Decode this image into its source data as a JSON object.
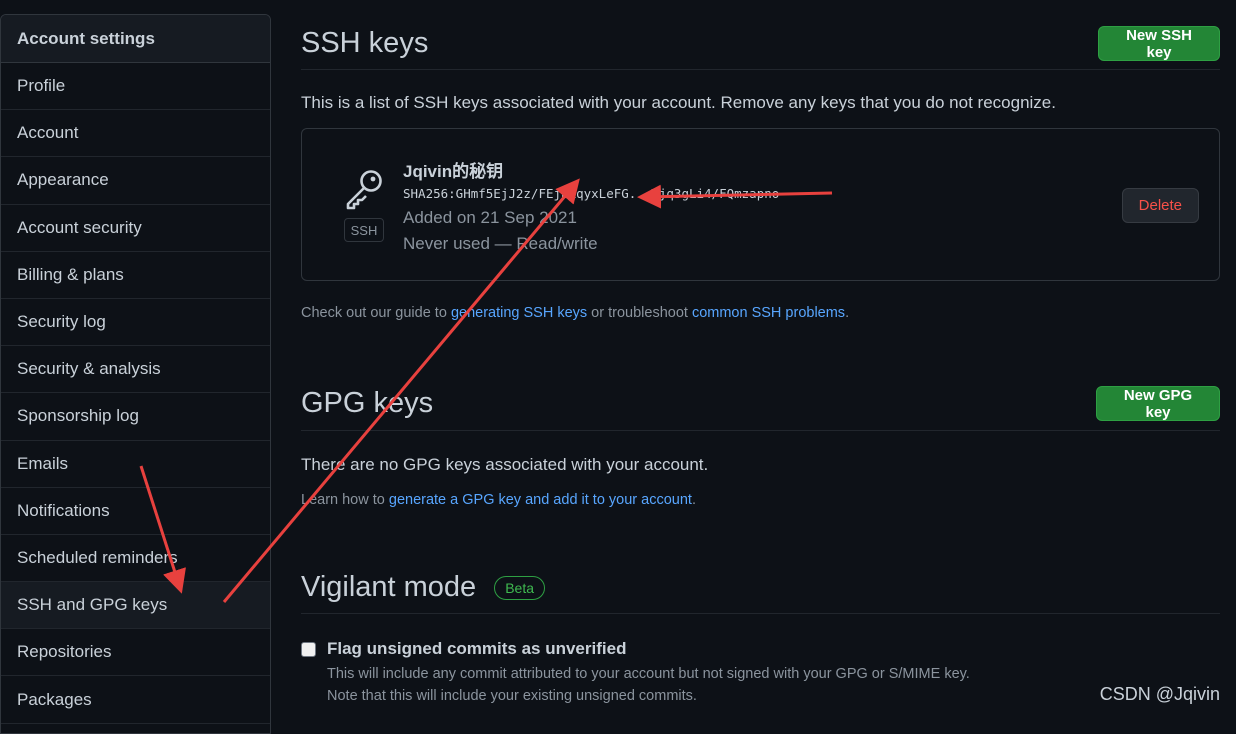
{
  "sidebar": {
    "header": "Account settings",
    "items": [
      {
        "label": "Profile"
      },
      {
        "label": "Account"
      },
      {
        "label": "Appearance"
      },
      {
        "label": "Account security"
      },
      {
        "label": "Billing & plans"
      },
      {
        "label": "Security log"
      },
      {
        "label": "Security & analysis"
      },
      {
        "label": "Sponsorship log"
      },
      {
        "label": "Emails"
      },
      {
        "label": "Notifications"
      },
      {
        "label": "Scheduled reminders"
      },
      {
        "label": "SSH and GPG keys",
        "selected": true
      },
      {
        "label": "Repositories"
      },
      {
        "label": "Packages"
      }
    ]
  },
  "ssh": {
    "title": "SSH keys",
    "new_button": "New SSH key",
    "description": "This is a list of SSH keys associated with your account. Remove any keys that you do not recognize.",
    "key": {
      "icon": "key-icon",
      "badge": "SSH",
      "name": "Jqivin的秘钥",
      "fingerprint": "SHA256:GHmf5EjJ2z/FEjbkqyxLeFG...Tjq3gLi4/FQmzapno",
      "added": "Added on 21 Sep 2021",
      "usage": "Never used — Read/write",
      "delete_label": "Delete"
    },
    "guide": {
      "prefix": "Check out our guide to ",
      "link1": "generating SSH keys",
      "middle": " or troubleshoot ",
      "link2": "common SSH problems",
      "suffix": "."
    }
  },
  "gpg": {
    "title": "GPG keys",
    "new_button": "New GPG key",
    "empty": "There are no GPG keys associated with your account.",
    "learn_prefix": "Learn how to ",
    "learn_link": "generate a GPG key and add it to your account",
    "learn_suffix": "."
  },
  "vigilant": {
    "title": "Vigilant mode",
    "badge": "Beta",
    "checkbox_label": "Flag unsigned commits as unverified",
    "checked": false,
    "note1": "This will include any commit attributed to your account but not signed with your GPG or S/MIME key.",
    "note2": "Note that this will include your existing unsigned commits."
  },
  "watermark": "CSDN @Jqivin",
  "colors": {
    "background": "#0d1117",
    "primary_button": "#238636",
    "link": "#58a6ff",
    "danger": "#f85149",
    "annotation_arrow": "#e8413e"
  }
}
